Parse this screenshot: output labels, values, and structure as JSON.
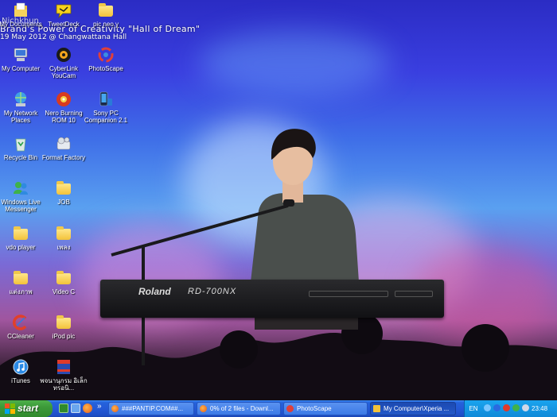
{
  "wallpaper": {
    "caption_line1": "Nichkhun",
    "caption_line2": "Brand's Power of Creativity \"Hall of Dream\"",
    "caption_line3": "19 May 2012 @ Changwattana Hall",
    "keyboard_brand": "Roland",
    "keyboard_model": "RD-700NX"
  },
  "desktop_icons": [
    {
      "label": "My Documents",
      "icon": "my-documents-icon"
    },
    {
      "label": "TweetDeck",
      "icon": "tweetdeck-icon"
    },
    {
      "label": "pic neo y",
      "icon": "folder-icon"
    },
    {
      "label": "My Computer",
      "icon": "my-computer-icon"
    },
    {
      "label": "CyberLink YouCam",
      "icon": "youcam-icon"
    },
    {
      "label": "PhotoScape",
      "icon": "photoscape-icon"
    },
    {
      "label": "My Network Places",
      "icon": "network-places-icon"
    },
    {
      "label": "Nero Burning ROM 10",
      "icon": "nero-icon"
    },
    {
      "label": "Sony PC Companion 2.1",
      "icon": "sony-pc-companion-icon"
    },
    {
      "label": "Recycle Bin",
      "icon": "recycle-bin-icon"
    },
    {
      "label": "Format Factory",
      "icon": "format-factory-icon"
    },
    {
      "label": "Windows Live Messenger",
      "icon": "messenger-icon"
    },
    {
      "label": "JOB",
      "icon": "folder-icon"
    },
    {
      "label": "vdo player",
      "icon": "folder-icon"
    },
    {
      "label": "เพลง",
      "icon": "folder-icon"
    },
    {
      "label": "แต่งภาพ",
      "icon": "folder-icon"
    },
    {
      "label": "Video C",
      "icon": "folder-icon"
    },
    {
      "label": "CCleaner",
      "icon": "ccleaner-icon"
    },
    {
      "label": "iPod pic",
      "icon": "folder-icon"
    },
    {
      "label": "iTunes",
      "icon": "itunes-icon"
    },
    {
      "label": "พจนานุกรม อิเล็กทรอนิ...",
      "icon": "dictionary-icon"
    }
  ],
  "taskbar": {
    "start_label": "start",
    "chevron": "»",
    "tasks": [
      {
        "label": "###PANTIP.COM##...",
        "icon": "firefox-icon"
      },
      {
        "label": "0% of 2 files - Downl...",
        "icon": "firefox-icon"
      },
      {
        "label": "PhotoScape",
        "icon": "photoscape-icon"
      },
      {
        "label": "My Computer\\Xperia ...",
        "icon": "folder-icon"
      }
    ],
    "tray": {
      "language": "EN",
      "clock": "23:48"
    }
  },
  "colors": {
    "taskbar_blue": "#2459d6",
    "start_green": "#3d9a39",
    "tray_blue": "#0f8ad8"
  }
}
